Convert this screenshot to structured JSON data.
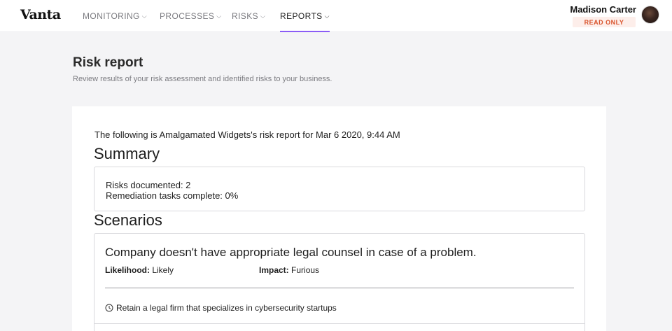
{
  "header": {
    "logo": "Vanta",
    "nav": [
      {
        "label": "MONITORING"
      },
      {
        "label": "PROCESSES"
      },
      {
        "label": "RISKS"
      },
      {
        "label": "REPORTS"
      }
    ],
    "user": {
      "name": "Madison Carter",
      "role_badge": "READ ONLY"
    },
    "accent": "#8b5cf6"
  },
  "page": {
    "title": "Risk report",
    "subtitle": "Review results of your risk assessment and identified risks to your business."
  },
  "report": {
    "intro": "The following is Amalgamated Widgets's risk report for Mar 6 2020, 9:44 AM",
    "summary_heading": "Summary",
    "summary_lines": [
      "Risks documented: 2",
      "Remediation tasks complete: 0%"
    ],
    "scenarios_heading": "Scenarios",
    "scenarios": [
      {
        "title": "Company doesn't have appropriate legal counsel in case of a problem.",
        "likelihood_label": "Likelihood:",
        "likelihood": "Likely",
        "impact_label": "Impact:",
        "impact": "Furious",
        "task": "Retain a legal firm that specializes in cybersecurity startups",
        "task_icon": "clock-icon"
      }
    ]
  }
}
